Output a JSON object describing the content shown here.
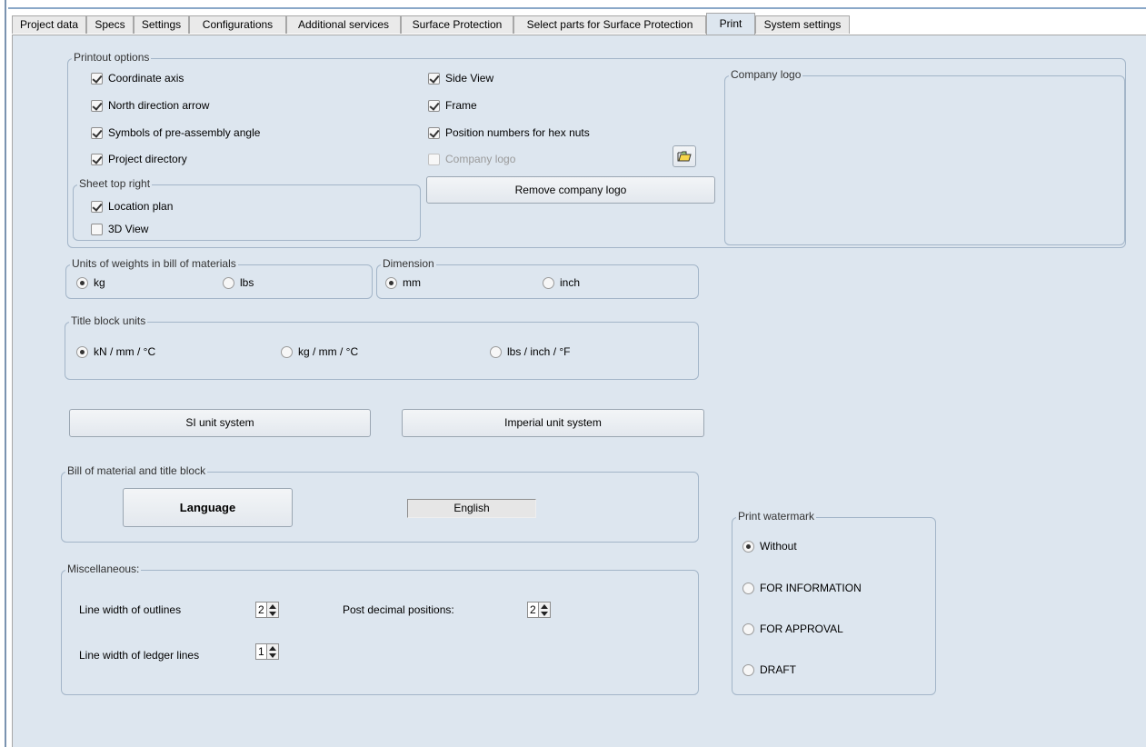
{
  "tabs": [
    {
      "label": "Project data"
    },
    {
      "label": "Specs"
    },
    {
      "label": "Settings"
    },
    {
      "label": "Configurations"
    },
    {
      "label": "Additional services"
    },
    {
      "label": "Surface Protection"
    },
    {
      "label": "Select parts for Surface Protection"
    },
    {
      "label": "Print",
      "active": true
    },
    {
      "label": "System settings"
    }
  ],
  "printout_options": {
    "title": "Printout options",
    "items": [
      {
        "label": "Coordinate axis",
        "checked": true
      },
      {
        "label": "North direction arrow",
        "checked": true
      },
      {
        "label": "Symbols of pre-assembly angle",
        "checked": true
      },
      {
        "label": "Project directory",
        "checked": true
      },
      {
        "label": "Side View",
        "checked": true
      },
      {
        "label": "Frame",
        "checked": true
      },
      {
        "label": "Position numbers for hex nuts",
        "checked": true
      },
      {
        "label": "Company logo",
        "checked": false,
        "disabled": true
      }
    ],
    "sheet_top_right": {
      "title": "Sheet top right",
      "items": [
        {
          "label": "Location plan",
          "checked": true
        },
        {
          "label": "3D View",
          "checked": false
        }
      ]
    },
    "remove_logo_label": "Remove company logo",
    "browse_icon": "folder-open-icon"
  },
  "company_logo": {
    "title": "Company logo"
  },
  "weight_units": {
    "title": "Units of weights in bill of materials",
    "options": [
      {
        "label": "kg",
        "selected": true
      },
      {
        "label": "lbs",
        "selected": false
      }
    ]
  },
  "dimension": {
    "title": "Dimension",
    "options": [
      {
        "label": "mm",
        "selected": true
      },
      {
        "label": "inch",
        "selected": false
      }
    ]
  },
  "title_block_units": {
    "title": "Title block units",
    "options": [
      {
        "label": "kN / mm / °C",
        "selected": true
      },
      {
        "label": "kg / mm / °C",
        "selected": false
      },
      {
        "label": "lbs / inch / °F",
        "selected": false
      }
    ]
  },
  "unit_buttons": {
    "si": "SI unit system",
    "imperial": "Imperial unit system"
  },
  "bill_of_material": {
    "title": "Bill of material and title block",
    "language_button": "Language",
    "language_value": "English"
  },
  "miscellaneous": {
    "title": "Miscellaneous:",
    "outline_width_label": "Line width of outlines",
    "outline_width_value": "2",
    "ledger_width_label": "Line width of ledger lines",
    "ledger_width_value": "1",
    "decimal_label": "Post decimal positions:",
    "decimal_value": "2"
  },
  "print_watermark": {
    "title": "Print watermark",
    "options": [
      {
        "label": "Without",
        "selected": true
      },
      {
        "label": "FOR INFORMATION",
        "selected": false
      },
      {
        "label": "FOR APPROVAL",
        "selected": false
      },
      {
        "label": "DRAFT",
        "selected": false
      }
    ]
  }
}
